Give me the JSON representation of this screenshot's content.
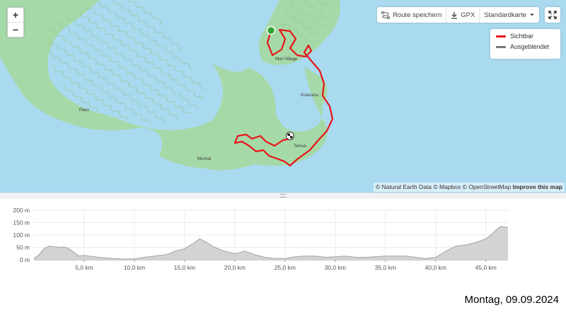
{
  "map": {
    "zoom_in": "+",
    "zoom_out": "−",
    "toolbar": {
      "save_route": "Route speichern",
      "gpx": "GPX",
      "map_style": "Standardkarte"
    },
    "legend": [
      {
        "label": "Sichtbar",
        "color": "#e8151b"
      },
      {
        "label": "Ausgeblendet",
        "color": "#777777"
      }
    ],
    "attribution": {
      "text": "© Natural Earth Data © Mapbox © OpenStreetMap",
      "improve": "Improve this map"
    },
    "places": [
      "Paeu",
      "Muri Village",
      "Kulavanu",
      "Temuo",
      "Murivai"
    ],
    "colors": {
      "water": "#aadaf0",
      "land": "#a6d9a8",
      "route": "#e8151b",
      "start": "#2fa52f"
    }
  },
  "chart_data": {
    "type": "area",
    "xlabel": "",
    "ylabel": "",
    "x_ticks": [
      "5,0 km",
      "10,0 km",
      "15,0 km",
      "20,0 km",
      "25,0 km",
      "30,0 km",
      "35,0 km",
      "40,0 km",
      "45,0 km"
    ],
    "y_ticks": [
      "200 m",
      "150 m",
      "100 m",
      "50 m",
      "0 m"
    ],
    "xlim": [
      0,
      47.2
    ],
    "ylim": [
      0,
      200
    ],
    "grid": true,
    "series": [
      {
        "x": [
          0,
          0.5,
          1,
          1.5,
          2,
          2.5,
          3,
          3.5,
          4,
          4.5,
          5,
          6,
          7,
          8,
          9,
          10,
          11,
          12,
          13,
          13.5,
          14,
          15,
          16,
          16.5,
          17,
          18,
          19,
          20,
          21,
          22,
          23,
          24,
          25,
          26,
          27,
          28,
          29,
          30,
          31,
          32,
          33,
          34,
          35,
          36,
          37,
          38,
          39,
          40,
          41,
          42,
          43,
          44,
          45,
          45.5,
          46,
          46.5,
          47.2
        ],
        "y": [
          5,
          20,
          45,
          55,
          53,
          50,
          52,
          45,
          30,
          15,
          18,
          12,
          8,
          5,
          3,
          4,
          10,
          15,
          20,
          25,
          35,
          45,
          70,
          85,
          75,
          50,
          35,
          25,
          35,
          20,
          10,
          5,
          5,
          12,
          15,
          15,
          10,
          12,
          15,
          10,
          10,
          12,
          15,
          15,
          15,
          10,
          5,
          10,
          35,
          55,
          60,
          70,
          85,
          100,
          120,
          135,
          130
        ]
      }
    ],
    "fill_color": "#d3d3d3",
    "line_color": "#a3a3a3"
  },
  "date": "Montag, 09.09.2024"
}
